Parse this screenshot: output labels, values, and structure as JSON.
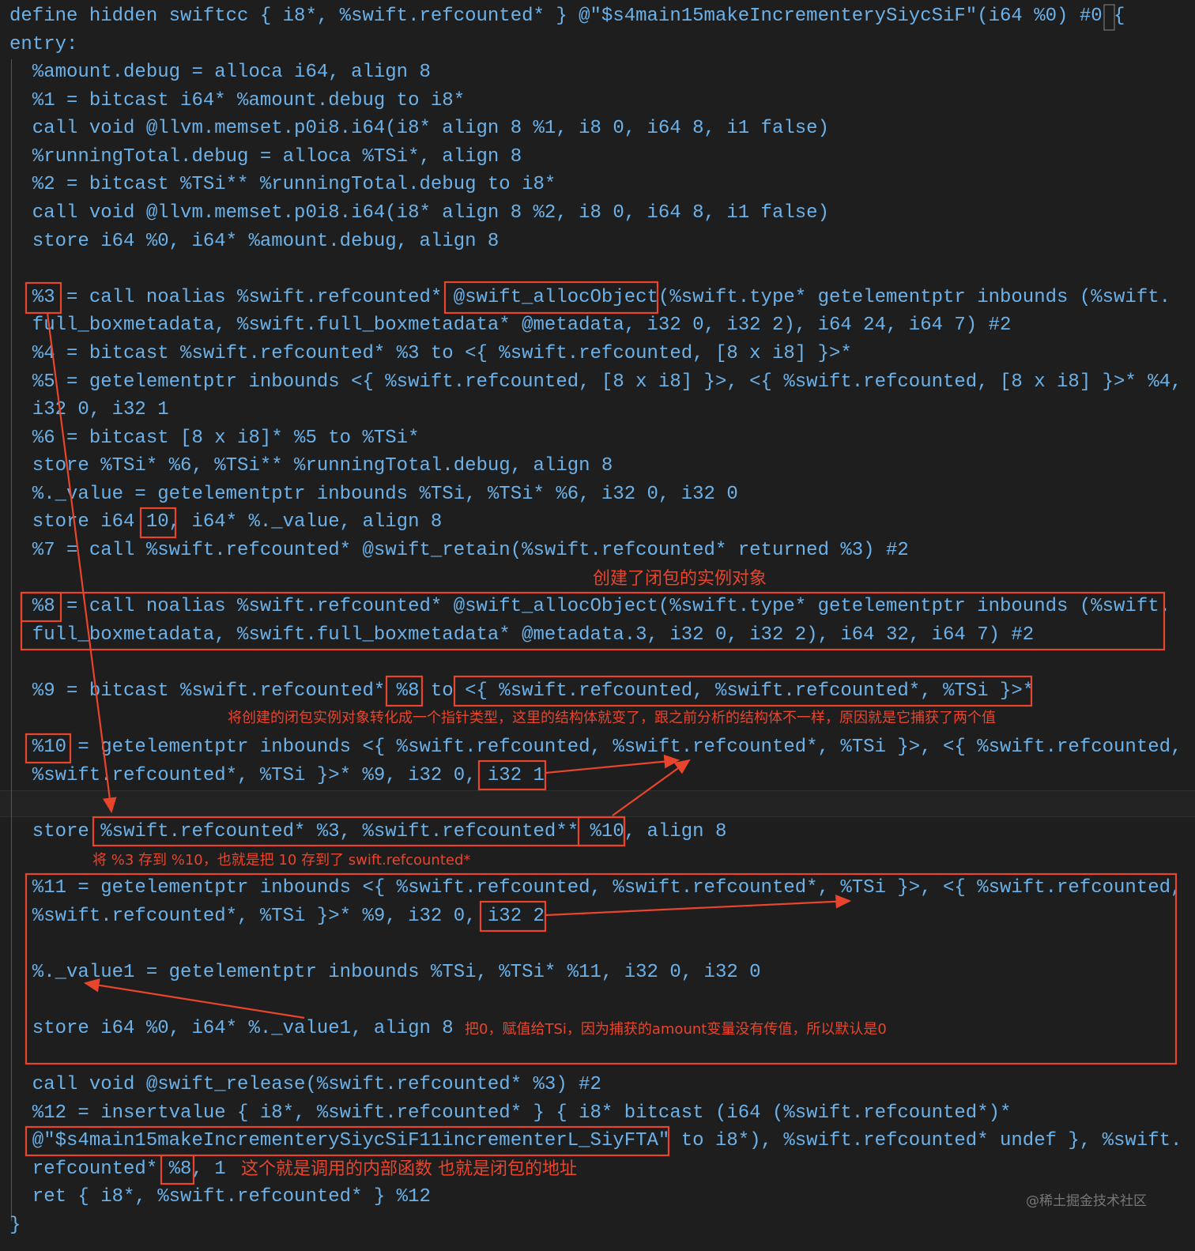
{
  "code_lines": [
    "define hidden swiftcc { i8*, %swift.refcounted* } @\"$s4main15makeIncrementerySiycSiF\"(i64 %0) #0 {",
    "entry:",
    "  %amount.debug = alloca i64, align 8",
    "  %1 = bitcast i64* %amount.debug to i8*",
    "  call void @llvm.memset.p0i8.i64(i8* align 8 %1, i8 0, i64 8, i1 false)",
    "  %runningTotal.debug = alloca %TSi*, align 8",
    "  %2 = bitcast %TSi** %runningTotal.debug to i8*",
    "  call void @llvm.memset.p0i8.i64(i8* align 8 %2, i8 0, i64 8, i1 false)",
    "  store i64 %0, i64* %amount.debug, align 8",
    "",
    "  %3 = call noalias %swift.refcounted* @swift_allocObject(%swift.type* getelementptr inbounds (%swift.",
    "  full_boxmetadata, %swift.full_boxmetadata* @metadata, i32 0, i32 2), i64 24, i64 7) #2",
    "  %4 = bitcast %swift.refcounted* %3 to <{ %swift.refcounted, [8 x i8] }>*",
    "  %5 = getelementptr inbounds <{ %swift.refcounted, [8 x i8] }>, <{ %swift.refcounted, [8 x i8] }>* %4,",
    "  i32 0, i32 1",
    "  %6 = bitcast [8 x i8]* %5 to %TSi*",
    "  store %TSi* %6, %TSi** %runningTotal.debug, align 8",
    "  %._value = getelementptr inbounds %TSi, %TSi* %6, i32 0, i32 0",
    "  store i64 10, i64* %._value, align 8",
    "  %7 = call %swift.refcounted* @swift_retain(%swift.refcounted* returned %3) #2",
    "",
    "  %8 = call noalias %swift.refcounted* @swift_allocObject(%swift.type* getelementptr inbounds (%swift.",
    "  full_boxmetadata, %swift.full_boxmetadata* @metadata.3, i32 0, i32 2), i64 32, i64 7) #2",
    "",
    "  %9 = bitcast %swift.refcounted* %8 to <{ %swift.refcounted, %swift.refcounted*, %TSi }>*",
    "",
    "  %10 = getelementptr inbounds <{ %swift.refcounted, %swift.refcounted*, %TSi }>, <{ %swift.refcounted,",
    "  %swift.refcounted*, %TSi }>* %9, i32 0, i32 1",
    "",
    "  store %swift.refcounted* %3, %swift.refcounted** %10, align 8",
    "",
    "  %11 = getelementptr inbounds <{ %swift.refcounted, %swift.refcounted*, %TSi }>, <{ %swift.refcounted,",
    "  %swift.refcounted*, %TSi }>* %9, i32 0, i32 2",
    "",
    "  %._value1 = getelementptr inbounds %TSi, %TSi* %11, i32 0, i32 0",
    "",
    "  store i64 %0, i64* %._value1, align 8",
    "",
    "  call void @swift_release(%swift.refcounted* %3) #2",
    "  %12 = insertvalue { i8*, %swift.refcounted* } { i8* bitcast (i64 (%swift.refcounted*)*",
    "  @\"$s4main15makeIncrementerySiycSiF11incrementerL_SiyFTA\" to i8*), %swift.refcounted* undef }, %swift.",
    "  refcounted* %8, 1",
    "  ret { i8*, %swift.refcounted* } %12",
    "}"
  ],
  "annotations": {
    "closure_instance": "创建了闭包的实例对象",
    "cast_pointer": "将创建的闭包实例对象转化成一个指针类型，这里的结构体就变了，跟之前分析的结构体不一样，原因就是它捕获了两个值",
    "store_3_to_10": "将 %3 存到 %10，也就是把 10 存到了 swift.refcounted*",
    "assign_zero": "把0，赋值给TSi，因为捕获的amount变量没有传值，所以默认是0",
    "inner_function": "这个就是调用的内部函数 也就是闭包的地址"
  },
  "watermark": "@稀土掘金技术社区",
  "colors": {
    "annotation": "#e8452c",
    "background": "#1e1e1e"
  }
}
